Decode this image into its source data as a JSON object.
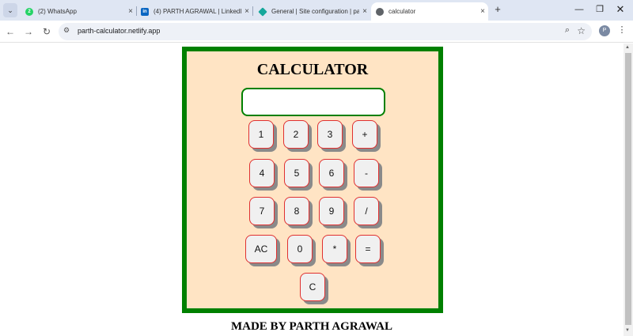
{
  "browser": {
    "tabs": [
      {
        "title": "(2) WhatsApp",
        "icon": "whatsapp-icon",
        "icon_color": "#25d366",
        "badge": "2"
      },
      {
        "title": "(4) PARTH AGRAWAL | LinkedIn",
        "icon": "linkedin-icon",
        "icon_color": "#0a66c2",
        "badge": "in"
      },
      {
        "title": "General | Site configuration | pa",
        "icon": "netlify-icon",
        "icon_color": "#15a79b",
        "badge": ""
      },
      {
        "title": "calculator",
        "icon": "globe-icon",
        "icon_color": "#5f6368",
        "badge": ""
      }
    ],
    "close_glyph": "×",
    "new_tab_glyph": "+",
    "address": "parth-calculator.netlify.app",
    "profile_initial": "P"
  },
  "calculator": {
    "title": "CALCULATOR",
    "display_value": "",
    "keys": [
      {
        "label": "1",
        "name": "key-1"
      },
      {
        "label": "2",
        "name": "key-2"
      },
      {
        "label": "3",
        "name": "key-3"
      },
      {
        "label": "+",
        "name": "key-plus"
      },
      {
        "label": "4",
        "name": "key-4"
      },
      {
        "label": "5",
        "name": "key-5"
      },
      {
        "label": "6",
        "name": "key-6"
      },
      {
        "label": "-",
        "name": "key-minus"
      },
      {
        "label": "7",
        "name": "key-7"
      },
      {
        "label": "8",
        "name": "key-8"
      },
      {
        "label": "9",
        "name": "key-9"
      },
      {
        "label": "/",
        "name": "key-divide"
      },
      {
        "label": "AC",
        "name": "key-all-clear"
      },
      {
        "label": "0",
        "name": "key-0"
      },
      {
        "label": "*",
        "name": "key-multiply"
      },
      {
        "label": "=",
        "name": "key-equals"
      },
      {
        "label": "C",
        "name": "key-clear"
      }
    ]
  },
  "footer": {
    "text": "MADE BY PARTH AGRAWAL"
  },
  "colors": {
    "panel_bg": "#ffe4c4",
    "panel_border": "#008000",
    "key_border": "#e03030",
    "key_shadow": "#8a8a8a"
  }
}
